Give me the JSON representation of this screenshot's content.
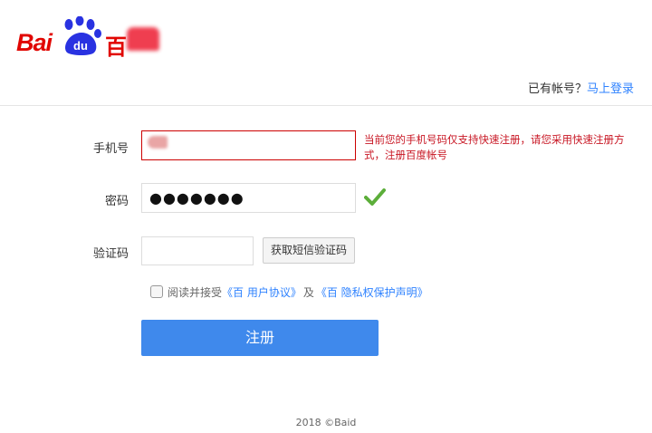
{
  "header": {
    "logo_latin": "Bai",
    "logo_badge": "du",
    "logo_cn": "百",
    "login_prompt": "已有帐号？",
    "login_link": "马上登录"
  },
  "form": {
    "phone_label": "手机号",
    "phone_value": "",
    "phone_error": "当前您的手机号码仅支持快速注册，请您采用快速注册方式，注册百度帐号",
    "password_label": "密码",
    "password_value": "●●●●●●●",
    "captcha_label": "验证码",
    "captcha_value": "",
    "sms_button": "获取短信验证码",
    "agree_text": "阅读并接受",
    "agreement_link": "《百 用户协议》",
    "agree_and": "及",
    "privacy_link": "《百 隐私权保护声明》",
    "register_button": "注册"
  },
  "footer": {
    "copyright": "2018 ©Baid"
  },
  "colors": {
    "brand_red": "#e10602",
    "link_blue": "#2e82ff",
    "button_blue": "#3f89ec",
    "error_red": "#c81623",
    "check_green": "#5cae3a"
  }
}
